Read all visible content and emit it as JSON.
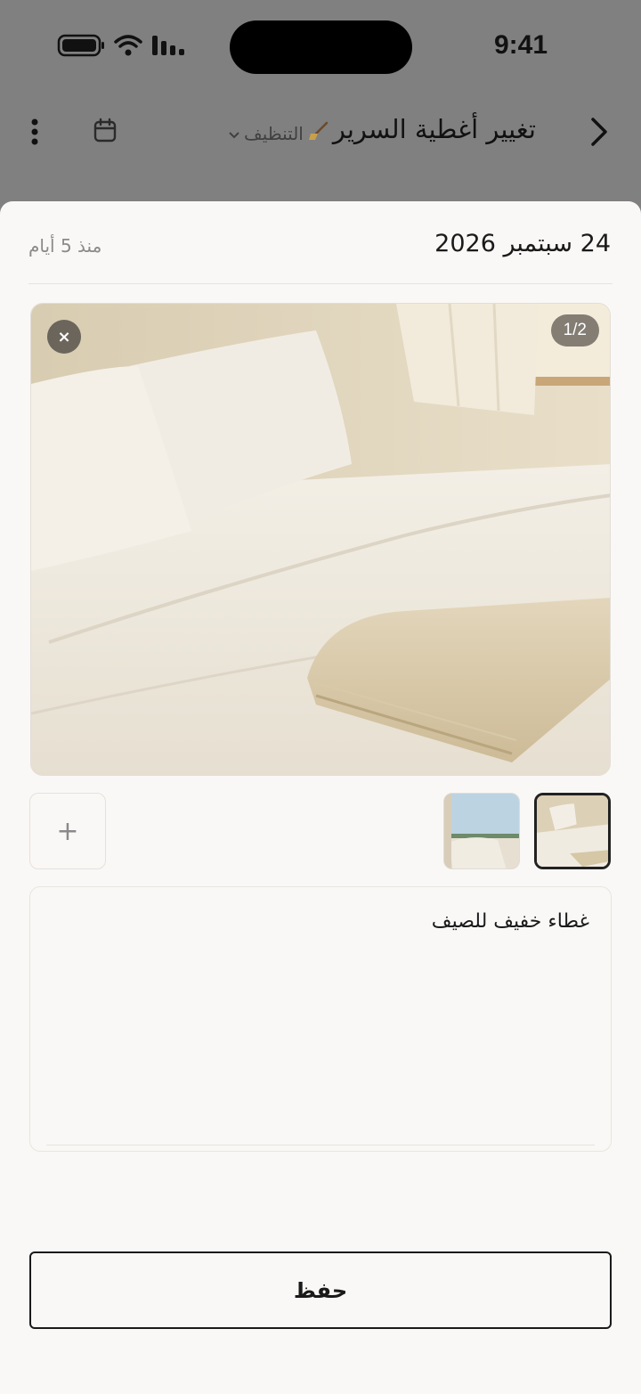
{
  "status_bar": {
    "time": "9:41"
  },
  "header": {
    "title": "تغيير أغطية السرير",
    "category": "التنظيف",
    "category_icon": "broom-icon"
  },
  "sheet": {
    "date": "24 سبتمبر 2026",
    "relative_time": "منذ 5 أيام",
    "photo": {
      "counter": "1/2",
      "remove_symbol": "×"
    },
    "add_photo_symbol": "+",
    "note_text": "غطاء خفيف للصيف",
    "save_label": "حفظ"
  },
  "colors": {
    "overlay": "#808080",
    "sheet_bg": "#faf8f6",
    "text_primary": "#1a1a1a",
    "text_muted": "#8a8a8a"
  }
}
